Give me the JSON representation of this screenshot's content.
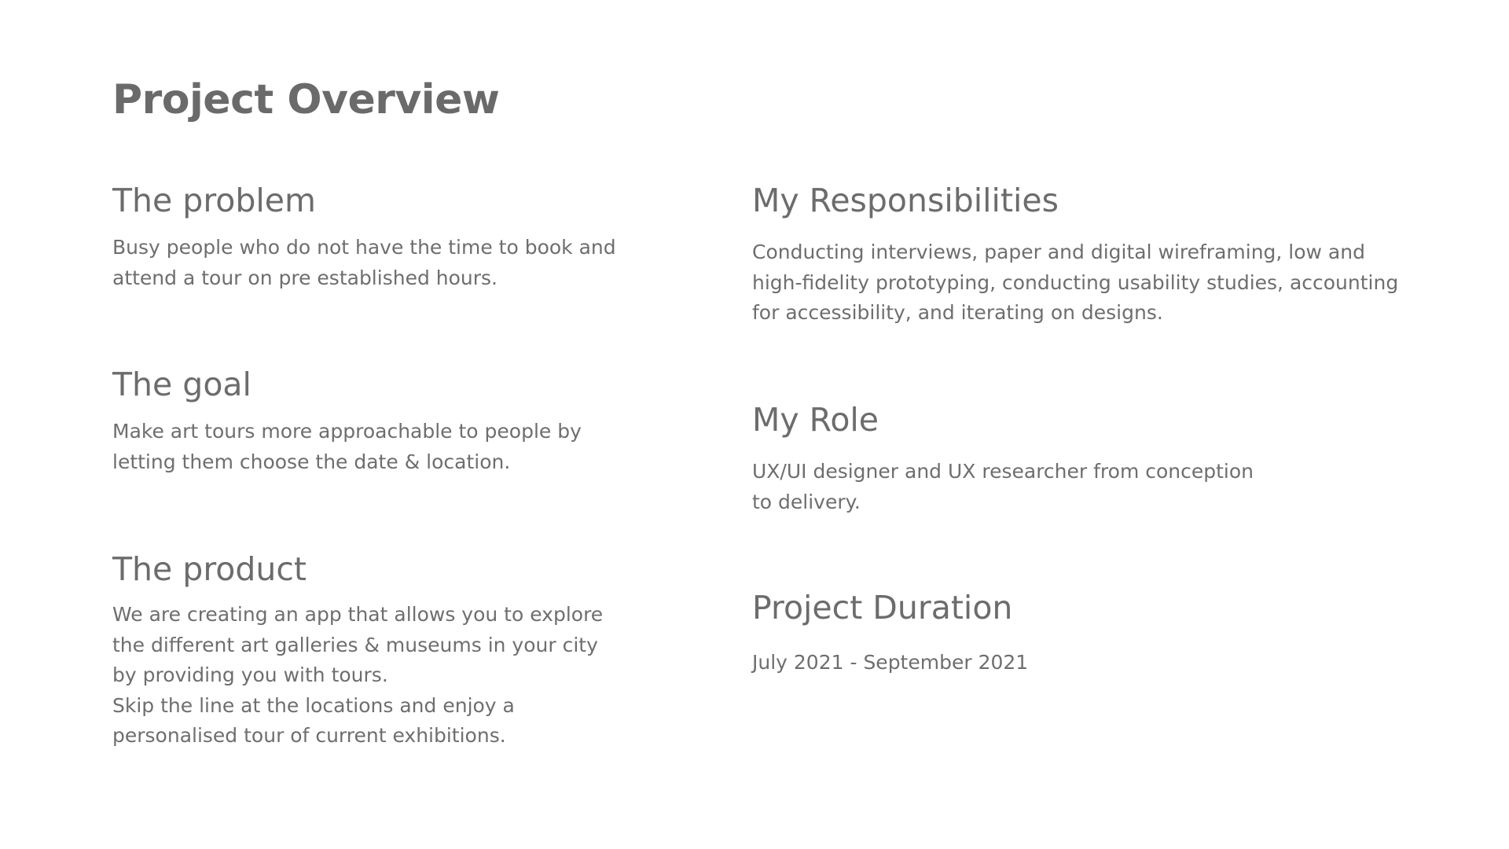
{
  "page": {
    "title": "Project Overview"
  },
  "left_column": {
    "problem": {
      "heading": "The problem",
      "body": "Busy people who do not have the time to book and\nattend a tour on pre established hours."
    },
    "goal": {
      "heading": "The goal",
      "body": "Make art tours more approachable to people by\nletting them choose the date & location."
    },
    "product": {
      "heading": "The product",
      "body": "We are creating an app that allows you to explore\nthe different art galleries & museums in your city\nby providing you with tours.\nSkip the line at the locations and enjoy a\npersonalised tour of current exhibitions."
    }
  },
  "right_column": {
    "responsibilities": {
      "heading": "My Responsibilities",
      "body": "Conducting interviews, paper and digital wireframing, low and\nhigh-fidelity prototyping, conducting usability studies, accounting\nfor accessibility, and iterating on designs."
    },
    "role": {
      "heading": "My Role",
      "body": "UX/UI designer and UX researcher from conception\nto delivery."
    },
    "duration": {
      "heading": "Project Duration",
      "body": "July 2021 - September 2021"
    }
  },
  "colors": {
    "background": "#ffffff",
    "text": "#6e6e6e",
    "heading": "#6a6a6a"
  }
}
